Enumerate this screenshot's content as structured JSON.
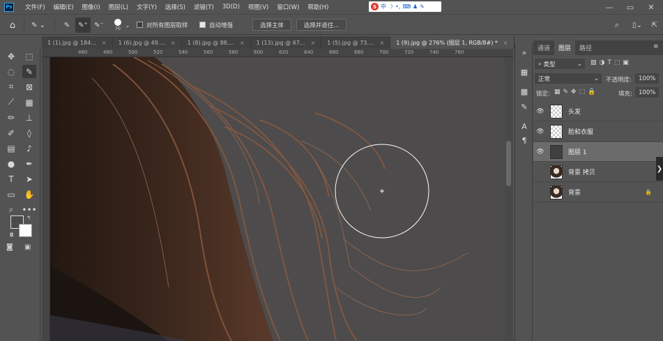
{
  "menubar": {
    "items": [
      "文件(F)",
      "编辑(E)",
      "图像(I)",
      "图层(L)",
      "文字(Y)",
      "选择(S)",
      "滤镜(T)",
      "3D(D)",
      "视图(V)",
      "窗口(W)",
      "帮助(H)"
    ],
    "app_logo": "Ps",
    "ime": {
      "logo": "S",
      "mode": "中"
    }
  },
  "options": {
    "brush_size": "70",
    "sample_all_label": "对所有图层取样",
    "sample_all_checked": false,
    "auto_enhance_label": "自动增强",
    "auto_enhance_checked": true,
    "select_subject_label": "选择主体",
    "select_mask_label": "选择并遮住..."
  },
  "tabs": [
    {
      "label": "1 (1).jpg @ 184...",
      "active": false
    },
    {
      "label": "1 (6).jpg @ 49....",
      "active": false
    },
    {
      "label": "1 (8).jpg @ 88....",
      "active": false
    },
    {
      "label": "1 (13).jpg @ 67...",
      "active": false
    },
    {
      "label": "1 (5).jpg @ 73....",
      "active": false
    },
    {
      "label": "1 (9).jpg @ 276% (图层 1, RGB/8#) *",
      "active": true
    }
  ],
  "ruler": {
    "h_ticks": [
      "460",
      "480",
      "500",
      "520",
      "540",
      "560",
      "580",
      "600",
      "620",
      "640",
      "660",
      "680",
      "700",
      "720",
      "740",
      "760"
    ]
  },
  "layers_panel": {
    "tabs": [
      "通道",
      "图层",
      "路径"
    ],
    "active_tab": "图层",
    "filter_label": "类型",
    "blend_mode": "正常",
    "opacity_label": "不透明度:",
    "opacity_value": "100%",
    "lock_label": "锁定:",
    "fill_label": "填充:",
    "fill_value": "100%",
    "layers": [
      {
        "name": "头发",
        "visible": true,
        "thumb": "check",
        "locked": false,
        "selected": false
      },
      {
        "name": "脸和衣服",
        "visible": true,
        "thumb": "check",
        "locked": false,
        "selected": false
      },
      {
        "name": "图层 1",
        "visible": true,
        "thumb": "dark",
        "locked": false,
        "selected": true
      },
      {
        "name": "背景 拷贝",
        "visible": false,
        "thumb": "photo",
        "locked": false,
        "selected": false
      },
      {
        "name": "背景",
        "visible": false,
        "thumb": "photo",
        "locked": true,
        "selected": false
      }
    ]
  },
  "colors": {
    "ui_bg": "#535353",
    "canvas_bg": "#4d4b4c",
    "hair_dark": "#2a1c16",
    "hair_light": "#9a6b4f"
  }
}
